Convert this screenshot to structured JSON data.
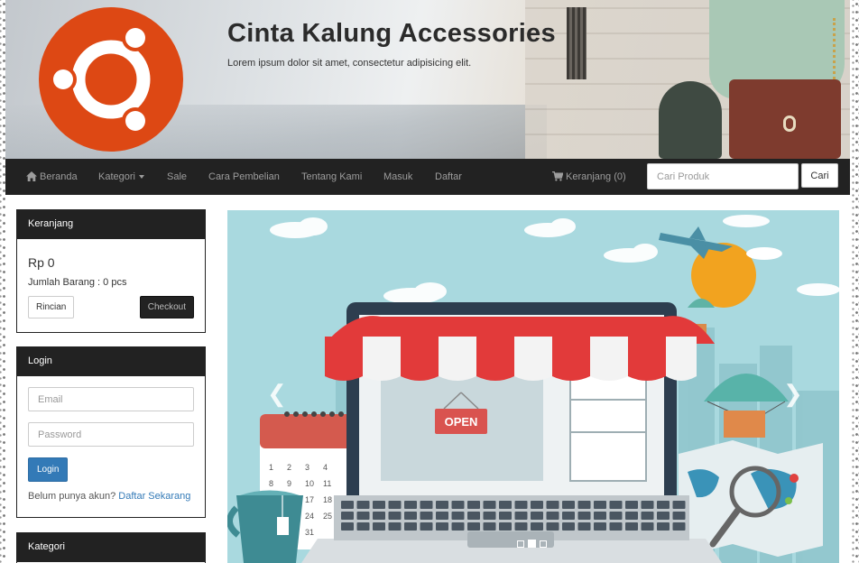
{
  "header": {
    "title": "Cinta Kalung Accessories",
    "tagline": "Lorem ipsum dolor sit amet, consectetur adipisicing elit."
  },
  "navbar": {
    "items": [
      "Beranda",
      "Kategori",
      "Sale",
      "Cara Pembelian",
      "Tentang Kami",
      "Masuk",
      "Daftar"
    ],
    "cart": "Keranjang (0)",
    "search_placeholder": "Cari Produk",
    "search_button": "Cari"
  },
  "cart_panel": {
    "heading": "Keranjang",
    "total": "Rp 0",
    "quantity": "Jumlah Barang : 0 pcs",
    "details_button": "Rincian",
    "checkout_button": "Checkout"
  },
  "login_panel": {
    "heading": "Login",
    "email_placeholder": "Email",
    "password_placeholder": "Password",
    "login_button": "Login",
    "register_prompt": "Belum punya akun?",
    "register_link": "Daftar Sekarang"
  },
  "category_panel": {
    "heading": "Kategori"
  },
  "carousel": {
    "sign": "OPEN",
    "calendar_numbers": [
      "1",
      "2",
      "3",
      "4",
      "8",
      "9",
      "10",
      "11",
      "17",
      "18",
      "24",
      "25",
      "31"
    ],
    "slide_count": 3,
    "active_slide": 2
  },
  "colors": {
    "navbar": "#222222",
    "primary_button": "#337ab7",
    "logo": "#dd4814",
    "sky": "#a9d9df"
  }
}
